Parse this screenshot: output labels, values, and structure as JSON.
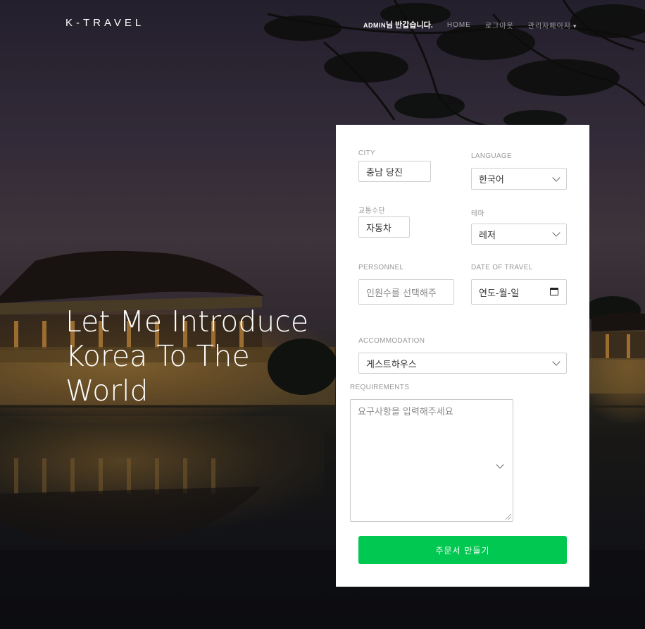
{
  "nav": {
    "brand": "K-TRAVEL",
    "greeting_user": "ADMIN",
    "greeting_suffix": "님 반갑습니다.",
    "links": [
      "HOME",
      "로그아웃",
      "관리자페이지"
    ]
  },
  "hero": {
    "line1": "Let Me Introduce",
    "line2": "Korea To The",
    "line3": "World"
  },
  "form": {
    "city_label": "CITY",
    "city_value": "충남 당진",
    "language_label": "LANGUAGE",
    "language_value": "한국어",
    "transport_label": "교통수단",
    "transport_value": "자동차",
    "theme_label": "테마",
    "theme_value": "레저",
    "personnel_label": "PERSONNEL",
    "personnel_placeholder": "인원수를 선택해주",
    "date_label": "DATE OF TRAVEL",
    "date_placeholder": "연도-월-일",
    "accommodation_label": "ACCOMMODATION",
    "accommodation_value": "게스트하우스",
    "requirements_label": "REQUIREMENTS",
    "requirements_placeholder": "요구사항을 입력해주세요",
    "submit_label": "주문서 만들기"
  },
  "colors": {
    "accent": "#00c851",
    "card": "#ffffff"
  }
}
